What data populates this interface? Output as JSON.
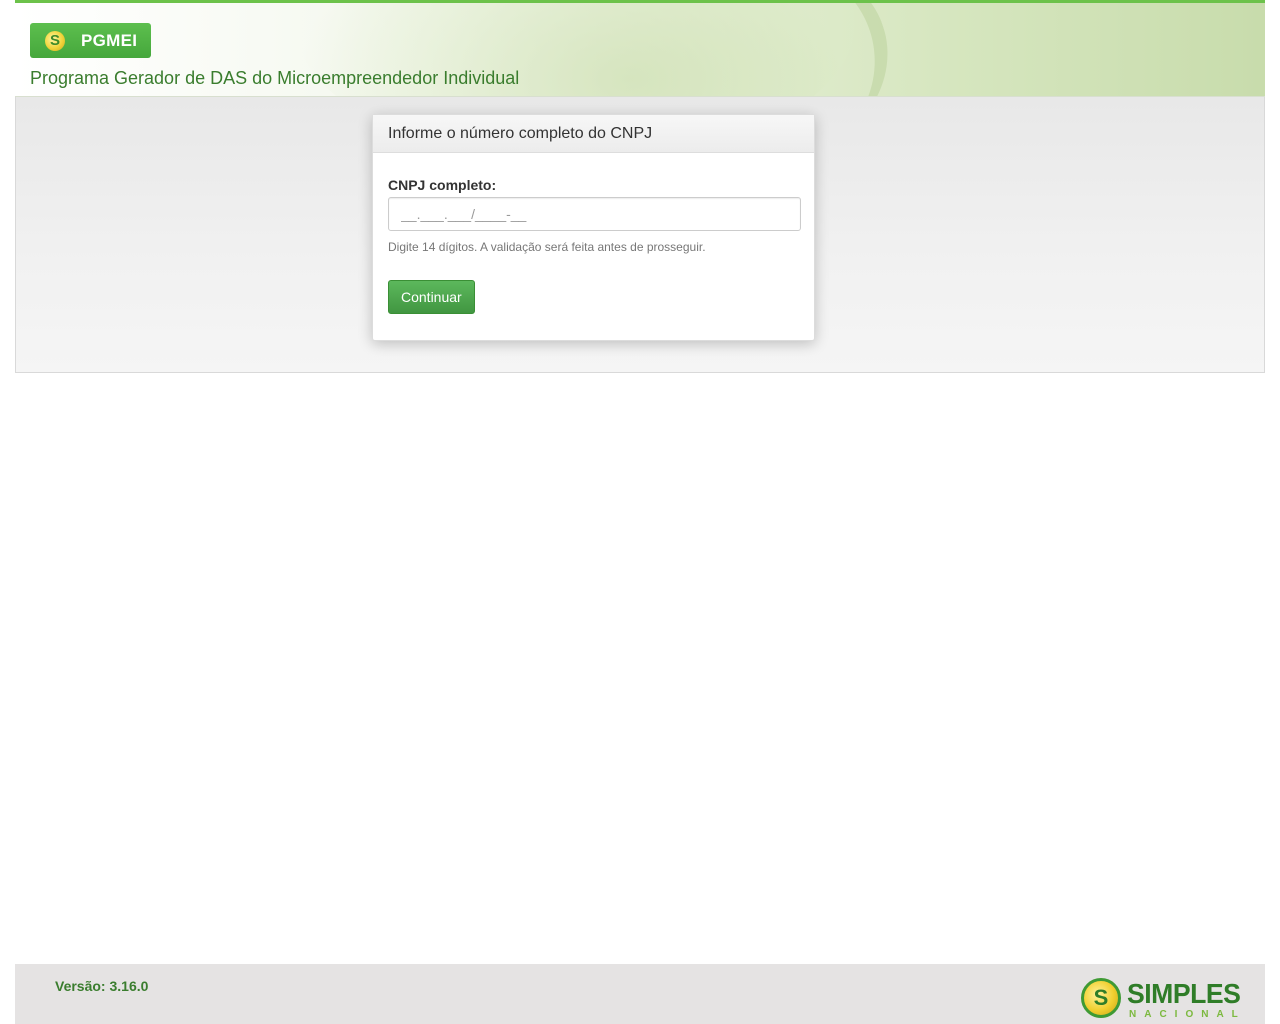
{
  "header": {
    "brand_label": "PGMEI",
    "subtitle": "Programa Gerador de DAS do Microempreendedor Individual",
    "brand_color": "#4cae44",
    "subtitle_color": "#3a7d2e"
  },
  "card": {
    "title": "Informe o número completo do CNPJ",
    "field_label": "CNPJ completo:",
    "input_value": "",
    "input_placeholder": "__.___.___/____-__",
    "help_text": "Digite 14 dígitos. A validação será feita antes de prosseguir.",
    "continue_label": "Continuar",
    "button_color": "#4cae4c"
  },
  "footer": {
    "version": "Versão: 3.16.0",
    "logo_text": "SIMPLES",
    "logo_subtext": "NACIONAL"
  },
  "icons": {
    "brand": "s-logo-icon",
    "footer": "simples-nacional-logo"
  }
}
